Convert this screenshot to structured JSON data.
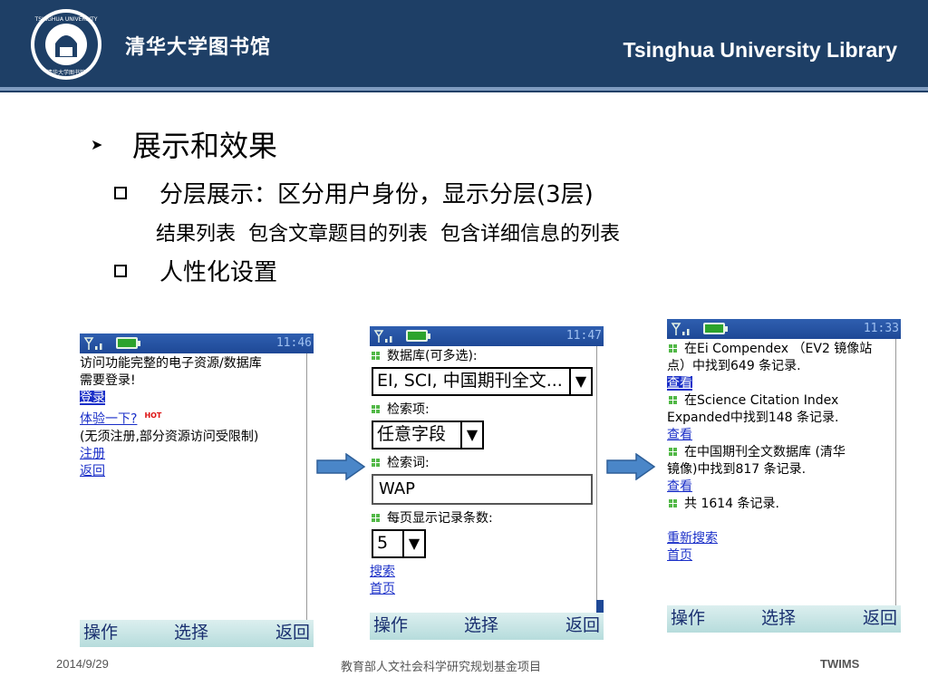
{
  "header": {
    "library_cn": "清华大学图书馆",
    "library_en": "Tsinghua University Library",
    "logo_icon": "tsinghua-seal-logo"
  },
  "bullets": {
    "level1": "展示和效果",
    "item1": "分层展示：区分用户身份，显示分层(3层)",
    "item1_sub": "结果列表  包含文章题目的列表  包含详细信息的列表",
    "item2": "人性化设置"
  },
  "phone1": {
    "time": "11:46",
    "line1": "访问功能完整的电子资源/数据库",
    "line2": "需要登录!",
    "login": "登录",
    "trial": "体验一下?",
    "hot": "HOT",
    "note": "(无须注册,部分资源访问受限制)",
    "register": "注册",
    "back": "返回",
    "soft_left": "操作",
    "soft_mid": "选择",
    "soft_right": "返回"
  },
  "phone2": {
    "time": "11:47",
    "db_label": "数据库(可多选):",
    "db_value": "EI, SCI, 中国期刊全文...",
    "field_label": "检索项:",
    "field_value": "任意字段",
    "keyword_label": "检索词:",
    "keyword_value": "WAP",
    "perpage_label": "每页显示记录条数:",
    "perpage_value": "5",
    "search": "搜索",
    "home": "首页",
    "soft_left": "操作",
    "soft_mid": "选择",
    "soft_right": "返回"
  },
  "phone3": {
    "time": "11:33",
    "r1_a": "在Ei Compendex （EV2 镜像站",
    "r1_b": "点）中找到649 条记录.",
    "view": "查看",
    "r2_a": "在Science Citation Index",
    "r2_b": "Expanded中找到148 条记录.",
    "r3_a": "在中国期刊全文数据库 (清华",
    "r3_b": "镜像)中找到817 条记录.",
    "total": "共 1614 条记录.",
    "research": "重新搜索",
    "home": "首页",
    "soft_left": "操作",
    "soft_mid": "选择",
    "soft_right": "返回"
  },
  "footer": {
    "date": "2014/9/29",
    "project": "教育部人文社会科学研究规划基金项目",
    "brand": "TWIMS"
  },
  "colors": {
    "header_bg": "#1e3f66",
    "statusbar": "#1e4896",
    "link": "#1a2fc8",
    "arrow": "#4a86c8"
  }
}
